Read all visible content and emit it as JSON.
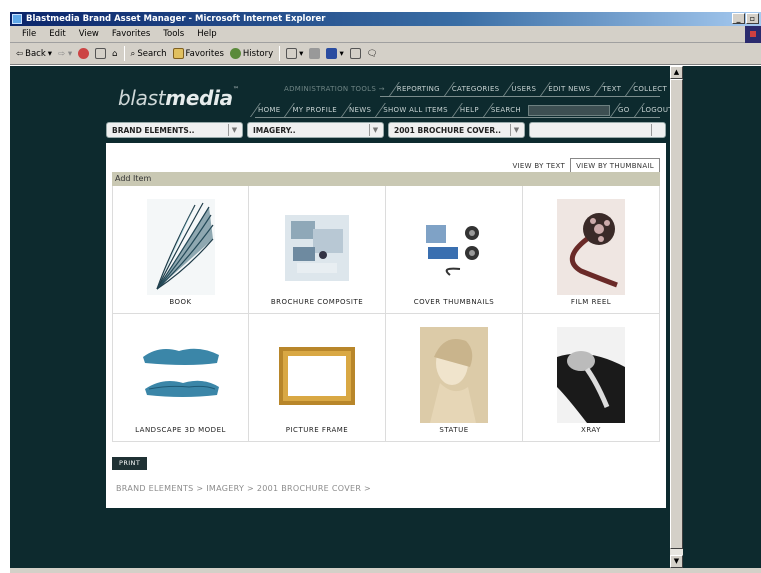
{
  "window": {
    "title": "Blastmedia Brand Asset Manager - Microsoft Internet Explorer",
    "minimize": "_",
    "restore": "©"
  },
  "menu": [
    "File",
    "Edit",
    "View",
    "Favorites",
    "Tools",
    "Help"
  ],
  "toolbar": {
    "back": "Back",
    "search": "Search",
    "favorites": "Favorites",
    "history": "History"
  },
  "logo": {
    "part1": "blast",
    "part2": "media",
    "tm": "™"
  },
  "nav": {
    "admin": "ADMINISTRATION TOOLS →",
    "row1": [
      "REPORTING",
      "CATEGORIES",
      "USERS",
      "EDIT NEWS",
      "TEXT",
      "COLLECT"
    ],
    "row2": [
      "HOME",
      "MY PROFILE",
      "NEWS",
      "SHOW ALL ITEMS",
      "HELP",
      "SEARCH"
    ],
    "go": "GO",
    "logout": "LOGOUT"
  },
  "dropdowns": [
    {
      "value": "BRAND ELEMENTS.."
    },
    {
      "value": "IMAGERY.."
    },
    {
      "value": "2001 BROCHURE COVER.."
    },
    {
      "value": ""
    }
  ],
  "view_tabs": {
    "text": "VIEW BY TEXT",
    "thumbnail": "VIEW BY THUMBNAIL",
    "active": "thumbnail"
  },
  "add_item": "Add Item",
  "items": [
    {
      "label": "BOOK",
      "icon": "book-thumbnail"
    },
    {
      "label": "BROCHURE COMPOSITE",
      "icon": "brochure-thumbnail"
    },
    {
      "label": "COVER THUMBNAILS",
      "icon": "cover-thumbnail"
    },
    {
      "label": "FILM REEL",
      "icon": "film-reel-thumbnail"
    },
    {
      "label": "LANDSCAPE 3D MODEL",
      "icon": "landscape-thumbnail"
    },
    {
      "label": "PICTURE FRAME",
      "icon": "frame-thumbnail"
    },
    {
      "label": "STATUE",
      "icon": "statue-thumbnail"
    },
    {
      "label": "XRAY",
      "icon": "xray-thumbnail"
    }
  ],
  "print": "PRINT",
  "breadcrumb": "BRAND ELEMENTS > IMAGERY > 2001 BROCHURE COVER >",
  "colors": {
    "page_bg": "#0d2a2e",
    "add_bar": "#c9c8b3",
    "nav_text": "#c7d2d2"
  }
}
